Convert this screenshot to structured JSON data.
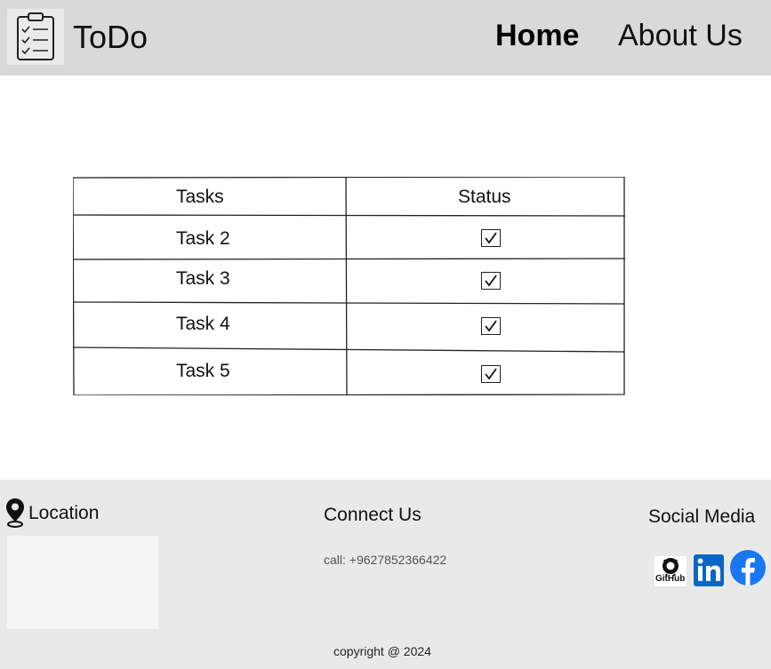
{
  "header": {
    "brand": "ToDo",
    "nav": {
      "home": "Home",
      "about": "About Us"
    }
  },
  "table": {
    "headers": [
      "Tasks",
      "Status"
    ],
    "rows": [
      {
        "task": "Task 2",
        "checked": true
      },
      {
        "task": "Task 3",
        "checked": true
      },
      {
        "task": "Task 4",
        "checked": true
      },
      {
        "task": "Task 5",
        "checked": true
      }
    ]
  },
  "footer": {
    "location_title": "Location",
    "connect_title": "Connect Us",
    "phone": "call: +9627852366422",
    "social_title": "Social Media",
    "github_label": "GitHub",
    "copyright": "copyright @ 2024"
  },
  "colors": {
    "facebook": "#1877F2",
    "linkedin": "#0A66C2"
  }
}
